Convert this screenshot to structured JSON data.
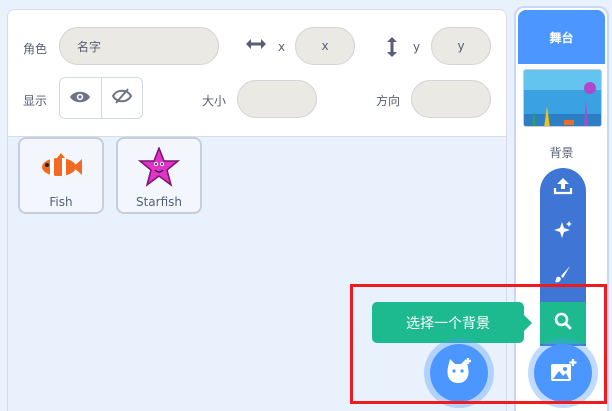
{
  "sprite_info": {
    "sprite_label": "角色",
    "name_placeholder": "名字",
    "x_label": "x",
    "x_placeholder": "x",
    "y_label": "y",
    "y_placeholder": "y",
    "show_label": "显示",
    "size_label": "大小",
    "direction_label": "方向"
  },
  "sprites": [
    {
      "name": "Fish",
      "icon": "clownfish-icon"
    },
    {
      "name": "Starfish",
      "icon": "starfish-icon"
    }
  ],
  "stage": {
    "header": "舞台",
    "backdrop_label": "背景"
  },
  "backdrop_menu": {
    "tooltip": "选择一个背景",
    "items": [
      "upload-icon",
      "surprise-icon",
      "paint-icon",
      "search-icon"
    ]
  },
  "colors": {
    "accent": "#4c97ff",
    "search_green": "#1cba8e",
    "flyout_blue": "#3f76d6",
    "highlight_red": "#ee1c1c"
  }
}
